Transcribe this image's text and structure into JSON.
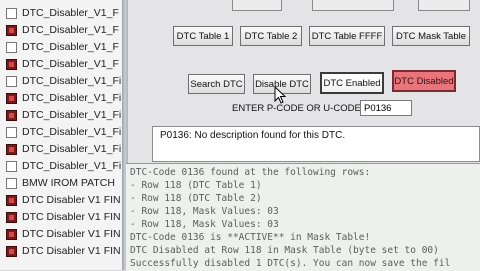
{
  "files": [
    {
      "name": "DTC_Disabler_V1_F",
      "icon": "generic"
    },
    {
      "name": "DTC_Disabler_V1_F",
      "icon": "dark"
    },
    {
      "name": "DTC_Disabler_V1_F",
      "icon": "generic"
    },
    {
      "name": "DTC_Disabler_V1_F",
      "icon": "dark"
    },
    {
      "name": "DTC_Disabler_V1_Fi",
      "icon": "generic"
    },
    {
      "name": "DTC_Disabler_V1_Fi",
      "icon": "dark"
    },
    {
      "name": "DTC_Disabler_V1_Fi",
      "icon": "dark"
    },
    {
      "name": "DTC_Disabler_V1_Fi",
      "icon": "generic"
    },
    {
      "name": "DTC_Disabler_V1_Fi",
      "icon": "dark"
    },
    {
      "name": "DTC_Disabler_V1_Fi",
      "icon": "generic"
    },
    {
      "name": "BMW IROM PATCH",
      "icon": "generic"
    },
    {
      "name": "DTC Disabler V1 FIN",
      "icon": "dark"
    },
    {
      "name": "DTC Disabler V1 FIN",
      "icon": "dark"
    },
    {
      "name": "DTC Disabler V1 FIN",
      "icon": "dark"
    },
    {
      "name": "DTC Disabler V1 FIN",
      "icon": "dark"
    }
  ],
  "table_buttons": {
    "dtc_table_1": "DTC Table 1",
    "dtc_table_2": "DTC Table 2",
    "dtc_table_ffff": "DTC Table FFFF",
    "dtc_mask_table": "DTC Mask Table"
  },
  "action_buttons": {
    "search": "Search DTC",
    "disable": "Disable DTC",
    "enabled": "DTC Enabled",
    "disabled": "DTC Disabled"
  },
  "code_entry": {
    "label": "ENTER P-CODE OR U-CODE:",
    "value": "P0136"
  },
  "message": "P0136: No description found for this DTC.",
  "log": [
    "DTC-Code 0136 found at the following rows:",
    "- Row 118 (DTC Table 1)",
    "- Row 118 (DTC Table 2)",
    "- Row 118, Mask Values: 03",
    "- Row 118, Mask Values: 03",
    "DTC-Code 0136 is **ACTIVE** in Mask Table!",
    "DTC Disabled at Row 118 in Mask Table (byte set to 00)",
    "Successfully disabled 1 DTC(s). You can now save the fil"
  ],
  "colors": {
    "danger_button": "#e8747c",
    "log_text": "#5c5c5c"
  }
}
